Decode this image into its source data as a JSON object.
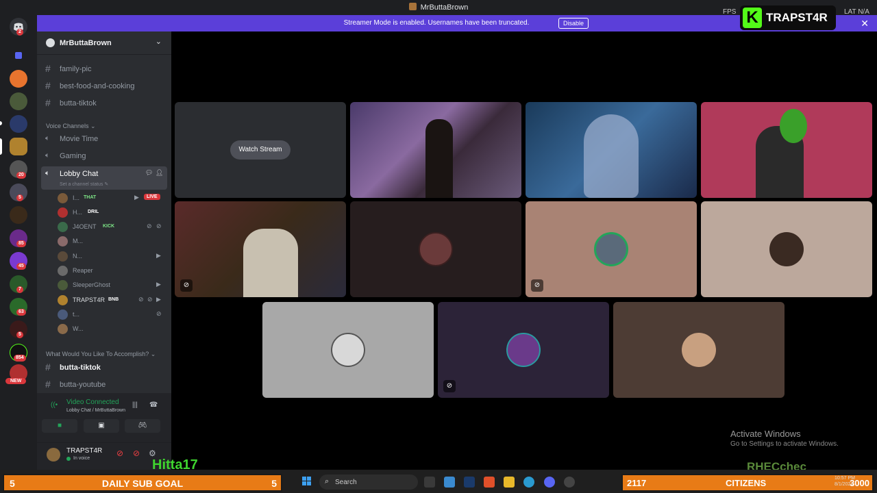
{
  "window": {
    "title": "MrButtaBrown",
    "fps_label": "FPS",
    "lat_label": "LAT",
    "lat_value": "N/A"
  },
  "banner": {
    "text": "Streamer Mode is enabled. Usernames have been truncated.",
    "disable_label": "Disable"
  },
  "overlay": {
    "kick_name": "TRAPST4R",
    "hitta": "Hitta17",
    "rhec": "RHECchec"
  },
  "rail": {
    "badges": [
      "2",
      "20",
      "5",
      "85",
      "45",
      "7",
      "63",
      "5",
      "854"
    ],
    "new_label": "NEW"
  },
  "server": {
    "name": "MrButtaBrown"
  },
  "channels": {
    "text_top": [
      "family-pic",
      "best-food-and-cooking",
      "butta-tiktok"
    ],
    "voice_category": "Voice Channels",
    "voice": [
      "Movie Time",
      "Gaming",
      "Lobby Chat"
    ],
    "lobby_status_hint": "Set a channel status",
    "users": [
      {
        "name": "I...",
        "tag": "THAT",
        "live": "LIVE"
      },
      {
        "name": "H...",
        "tag": "DRIL"
      },
      {
        "name": "J4OENT",
        "tag": "KICK"
      },
      {
        "name": "M..."
      },
      {
        "name": "N..."
      },
      {
        "name": "Reaper"
      },
      {
        "name": "SleeperGhost"
      },
      {
        "name": "TRAPST4R",
        "tag": "BNB"
      },
      {
        "name": "t..."
      },
      {
        "name": "W..."
      }
    ],
    "category2": "What Would You Like To Accomplish?",
    "text_bottom": [
      "butta-tiktok",
      "butta-youtube"
    ]
  },
  "voice_panel": {
    "status": "Video Connected",
    "location": "Lobby Chat / MrButtaBrown"
  },
  "user": {
    "name": "TRAPST4R",
    "status": "In voice"
  },
  "stage": {
    "watch_label": "Watch Stream"
  },
  "watermark": {
    "line1": "Activate Windows",
    "line2": "Go to Settings to activate Windows."
  },
  "goal": {
    "left_num": "5",
    "label": "DAILY SUB GOAL",
    "right_num": "5"
  },
  "citizens": {
    "left_num": "2117",
    "label": "CITIZENS",
    "right_num": "3000"
  },
  "taskbar": {
    "search": "Search",
    "time": "10:57 PM",
    "date": "8/1/2024"
  },
  "colors": {
    "accent": "#5b3fd9",
    "kick": "#53fc18",
    "goal": "#e87b16",
    "online": "#23a55a"
  }
}
